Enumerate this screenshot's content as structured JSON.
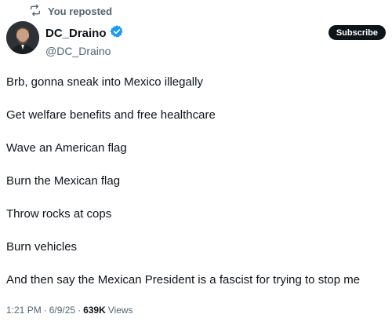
{
  "repost": {
    "icon": "repost-icon",
    "label": "You reposted"
  },
  "author": {
    "display_name": "DC_Draino",
    "handle": "@DC_Draino",
    "verified_icon": "verified-badge-icon",
    "verified_color": "#1d9bf0"
  },
  "subscribe_label": "Subscribe",
  "tweet": {
    "lines": [
      "Brb, gonna sneak into Mexico illegally",
      "Get welfare benefits and free healthcare",
      "Wave an American flag",
      "Burn the Mexican flag",
      "Throw rocks at cops",
      "Burn vehicles",
      "And then say the Mexican President is a fascist for trying to stop me"
    ]
  },
  "meta": {
    "time": "1:21 PM",
    "sep1": "·",
    "date": "6/9/25",
    "sep2": "·",
    "views_count": "639K",
    "views_label": "Views"
  }
}
